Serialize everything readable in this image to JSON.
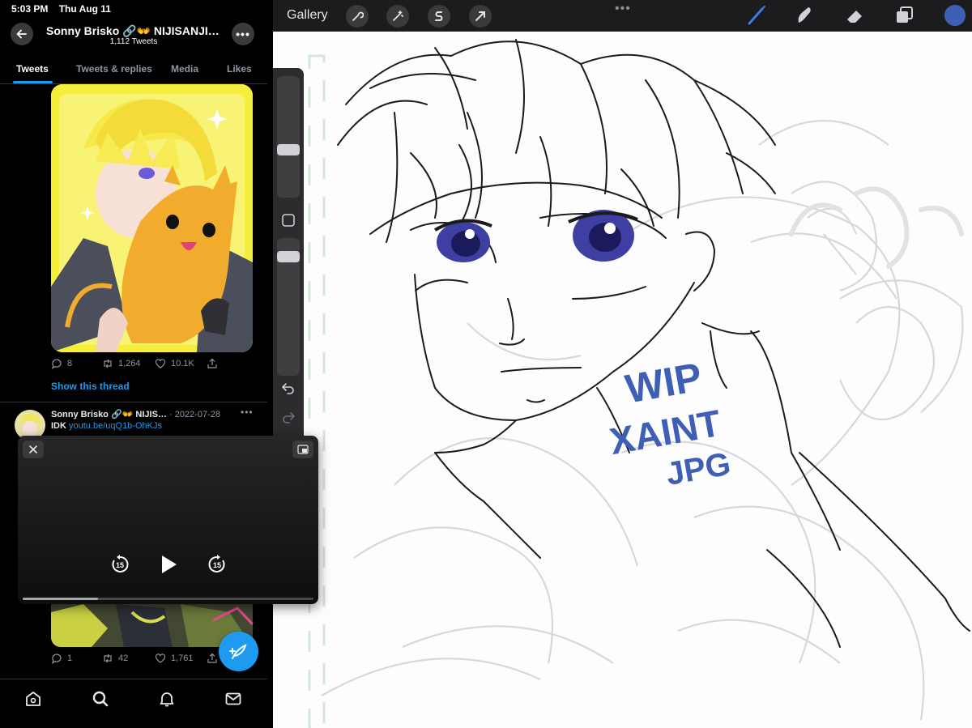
{
  "status_bar": {
    "time": "5:03 PM",
    "date": "Thu Aug 11"
  },
  "twitter": {
    "header": {
      "name": "Sonny Brisko 🔗👐 NIJISANJI…",
      "tweet_count": "1,112 Tweets"
    },
    "tabs": [
      {
        "label": "Tweets",
        "active": true
      },
      {
        "label": "Tweets & replies",
        "active": false
      },
      {
        "label": "Media",
        "active": false
      },
      {
        "label": "Likes",
        "active": false
      }
    ],
    "tweet1": {
      "replies": "8",
      "retweets": "1,264",
      "likes": "10.1K",
      "show_thread": "Show this thread"
    },
    "tweet2": {
      "name": "Sonny Brisko 🔗👐 NIJIS…",
      "date": "· 2022-07-28",
      "text": "IDK",
      "link": "youtu.be/uqQ1b-OhKJs"
    },
    "tweet3": {
      "replies": "1",
      "retweets": "42",
      "likes": "1,761"
    },
    "nav": [
      "home-icon",
      "search-icon",
      "notifications-icon",
      "messages-icon"
    ],
    "accent": "#1d9bf0"
  },
  "video_pip": {
    "skip_back_label": "15",
    "skip_forward_label": "15",
    "progress": 0.26
  },
  "procreate": {
    "gallery_label": "Gallery",
    "watermark": [
      "WIP",
      "XAINT",
      "JPG"
    ],
    "watermark_color": "#3e5fb4",
    "current_color": "#3e5fb4",
    "brush_size_level": 0.44,
    "opacity_level": 0.58
  }
}
